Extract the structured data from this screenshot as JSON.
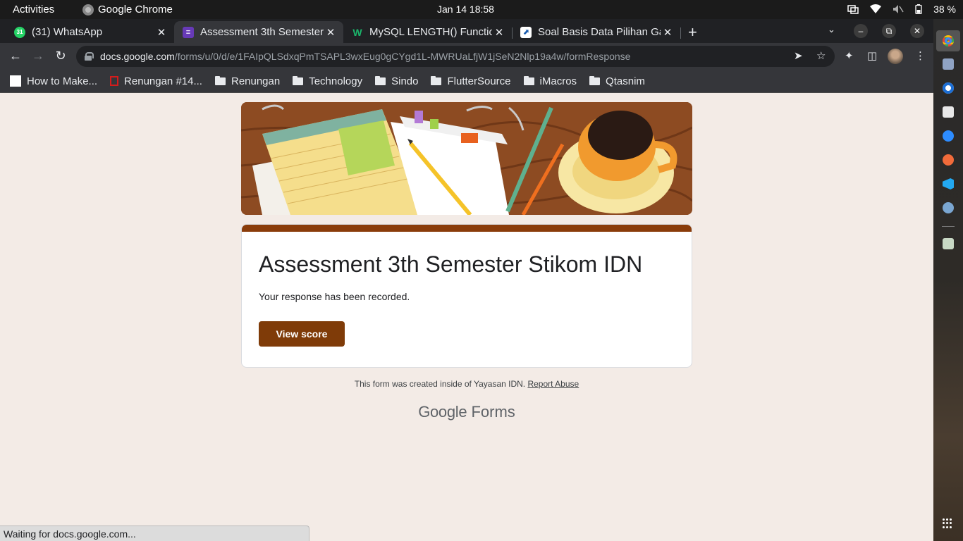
{
  "system": {
    "activities": "Activities",
    "app_name": "Google Chrome",
    "clock": "Jan 14  18:58",
    "battery": "38 %"
  },
  "tabs": [
    {
      "title": "(31) WhatsApp",
      "close": "✕",
      "fav_color": "#25d366",
      "fav_text": "31"
    },
    {
      "title": "Assessment 3th Semester",
      "close": "✕",
      "fav_color": "#673ab7",
      "fav_text": "≡",
      "active": true
    },
    {
      "title": "MySQL LENGTH() Functio",
      "close": "✕",
      "fav_color": "#202124",
      "fav_text": "W"
    },
    {
      "title": "Soal Basis Data Pilihan Ga",
      "close": "✕",
      "fav_color": "#ffffff",
      "fav_text": "⬈"
    }
  ],
  "toolbar": {
    "url_host": "docs.google.com",
    "url_path": "/forms/u/0/d/e/1FAIpQLSdxqPmTSAPL3wxEug0gCYgd1L-MWRUaLfjW1jSeN2Nlp19a4w/formResponse",
    "new_tab": "+"
  },
  "bookmarks": [
    {
      "label": "How to Make...",
      "icon": "page-favicon"
    },
    {
      "label": "Renungan #14...",
      "icon": "red-square-favicon"
    },
    {
      "label": "Renungan",
      "icon": "folder-icon"
    },
    {
      "label": "Technology",
      "icon": "folder-icon"
    },
    {
      "label": "Sindo",
      "icon": "folder-icon"
    },
    {
      "label": "FlutterSource",
      "icon": "folder-icon"
    },
    {
      "label": "iMacros",
      "icon": "folder-icon"
    },
    {
      "label": "Qtasnim",
      "icon": "folder-icon"
    }
  ],
  "form": {
    "title": "Assessment 3th Semester Stikom IDN",
    "message": "Your response has been recorded.",
    "view_score": "View score",
    "footer_text": "This form was created inside of Yayasan IDN.",
    "report_abuse": "Report Abuse",
    "brand_google": "Google",
    "brand_forms": "Forms",
    "accent_color": "#8a3c0a"
  },
  "status": {
    "text": "Waiting for docs.google.com..."
  }
}
